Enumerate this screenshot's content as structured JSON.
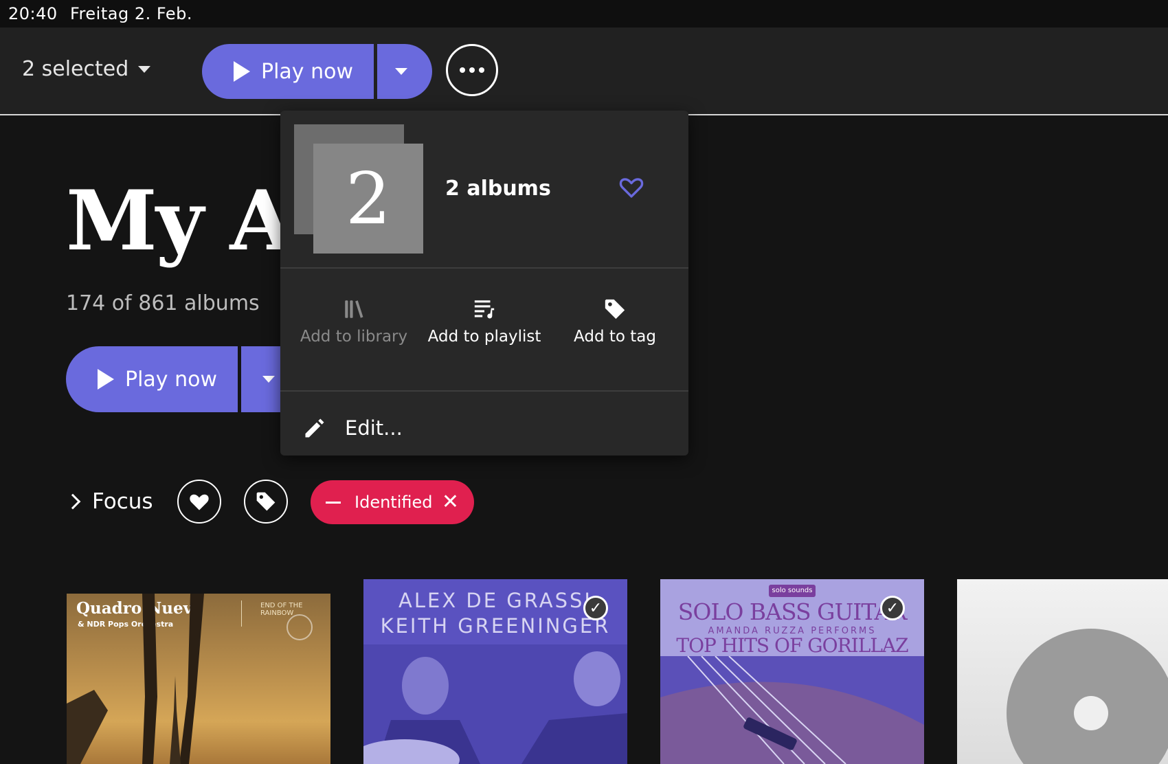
{
  "status_bar": {
    "time": "20:40",
    "date": "Freitag 2. Feb."
  },
  "toolbar": {
    "selection_label": "2 selected",
    "play_label": "Play now",
    "more_icon": "more-horizontal-icon"
  },
  "page": {
    "title": "My Al",
    "subtitle": "174 of 861 albums",
    "play_label": "Play now"
  },
  "filters": {
    "focus_label": "Focus",
    "favorite_icon": "heart-icon",
    "tag_icon": "tag-icon",
    "chip_label": "Identified"
  },
  "menu": {
    "count": "2",
    "title": "2 albums",
    "actions": [
      {
        "label": "Add to library",
        "icon": "library-icon",
        "enabled": false
      },
      {
        "label": "Add to playlist",
        "icon": "playlist-add-icon",
        "enabled": true
      },
      {
        "label": "Add to tag",
        "icon": "tag-icon",
        "enabled": true
      }
    ],
    "edit_label": "Edit..."
  },
  "albums": [
    {
      "title_text": "Quadro Nuevo",
      "subtitle_text": "& NDR Pops Orchestra",
      "side_text": "END OF THE RAINBOW",
      "selected": false
    },
    {
      "line1": "ALEX DE GRASSI",
      "line2": "KEITH GREENINGER",
      "selected": true
    },
    {
      "badge": "solo sounds",
      "line1": "SOLO BASS GUITAR",
      "line2": "AMANDA RUZZA PERFORMS",
      "line3": "TOP HITS OF GORILLAZ",
      "selected": true
    },
    {
      "placeholder": true,
      "selected": false
    }
  ],
  "colors": {
    "accent": "#6a6add",
    "chip": "#e0204f",
    "menu_bg": "#282828",
    "toolbar_bg": "#212121"
  }
}
